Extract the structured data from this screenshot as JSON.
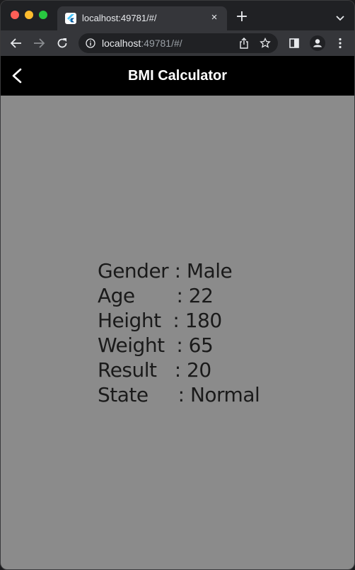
{
  "browser": {
    "tab_title": "localhost:49781/#/",
    "new_tab_symbol": "+",
    "close_symbol": "×",
    "url_host": "localhost",
    "url_rest": ":49781/#/"
  },
  "appbar": {
    "title": "BMI Calculator"
  },
  "results": [
    {
      "text": "Gender : Male"
    },
    {
      "text": "Age       : 22"
    },
    {
      "text": "Height  : 180"
    },
    {
      "text": "Weight  : 65"
    },
    {
      "text": "Result   : 20"
    },
    {
      "text": "State     : Normal"
    }
  ],
  "colors": {
    "appbar_bg": "#000000",
    "content_bg": "#8b8b8b",
    "text": "#1a1a1a"
  }
}
